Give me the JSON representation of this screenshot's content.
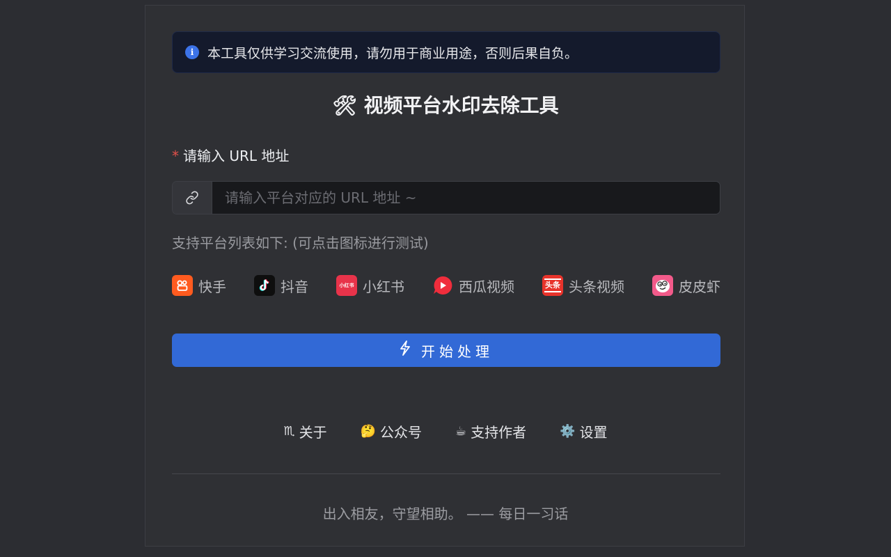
{
  "alert": {
    "icon": "info-icon",
    "icon_glyph": "i",
    "text": "本工具仅供学习交流使用，请勿用于商业用途，否则后果自负。"
  },
  "title": {
    "emoji": "🛠",
    "text": "视频平台水印去除工具"
  },
  "form": {
    "required_mark": "*",
    "label": "请输入 URL 地址",
    "prefix_icon": "link-icon",
    "input_value": "",
    "input_placeholder": "请输入平台对应的 URL 地址 ~"
  },
  "platforms": {
    "hint": "支持平台列表如下: (可点击图标进行测试)",
    "items": [
      {
        "name": "快手",
        "icon": "kuaishou-icon",
        "color": "#ff5b1f"
      },
      {
        "name": "抖音",
        "icon": "douyin-icon",
        "color": "#0e0e0e"
      },
      {
        "name": "小红书",
        "icon": "xiaohongshu-icon",
        "color": "#e8334a",
        "icon_text": "小红书"
      },
      {
        "name": "西瓜视频",
        "icon": "xigua-icon",
        "color": "#f02d3c"
      },
      {
        "name": "头条视频",
        "icon": "toutiao-icon",
        "color": "#e8332b",
        "icon_text": "头条"
      },
      {
        "name": "皮皮虾",
        "icon": "pipixia-icon",
        "color": "#f25a8a"
      }
    ]
  },
  "start_button": {
    "icon": "bolt-icon",
    "label": "开始处理"
  },
  "links": [
    {
      "emoji": "♏",
      "label": "关于"
    },
    {
      "emoji": "🤔",
      "label": "公众号"
    },
    {
      "emoji": "☕",
      "label": "支持作者"
    },
    {
      "emoji": "⚙️",
      "label": "设置"
    }
  ],
  "quote": "出入相友，守望相助。 —— 每日一习话",
  "colors": {
    "accent": "#3269d6",
    "background": "#2c2d32",
    "alert_bg": "#141a2c",
    "required": "#e3504a"
  }
}
